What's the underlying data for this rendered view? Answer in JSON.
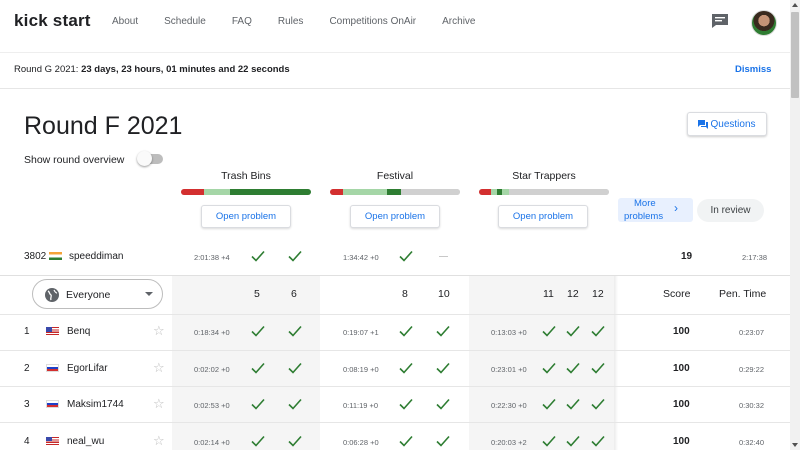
{
  "nav": {
    "logo": "kick start",
    "links": [
      "About",
      "Schedule",
      "FAQ",
      "Rules",
      "Competitions OnAir",
      "Archive"
    ]
  },
  "banner": {
    "label": "Round G 2021:",
    "countdown": "23 days, 23 hours, 01 minutes and 22 seconds",
    "dismiss": "Dismiss"
  },
  "round": {
    "title": "Round F 2021",
    "questions_label": "Questions",
    "overview_label": "Show round overview"
  },
  "problems": [
    {
      "name": "Trash Bins",
      "open_label": "Open problem",
      "bar": [
        [
          "#d32f2f",
          0.18
        ],
        [
          "#a5d6a7",
          0.2
        ],
        [
          "#2e7d32",
          0.62
        ]
      ]
    },
    {
      "name": "Festival",
      "open_label": "Open problem",
      "bar": [
        [
          "#d32f2f",
          0.1
        ],
        [
          "#a5d6a7",
          0.34
        ],
        [
          "#2e7d32",
          0.11
        ],
        [
          "#d0d0d0",
          0.45
        ]
      ]
    },
    {
      "name": "Star Trappers",
      "open_label": "Open problem",
      "bar": [
        [
          "#d32f2f",
          0.09
        ],
        [
          "#a5d6a7",
          0.05
        ],
        [
          "#2e7d32",
          0.04
        ],
        [
          "#a5d6a7",
          0.05
        ],
        [
          "#d0d0d0",
          0.77
        ]
      ]
    }
  ],
  "more_problems": {
    "line1": "More",
    "line2": "problems"
  },
  "in_review": "In review",
  "me": {
    "rank": "3802",
    "name": "speeddiman",
    "p1_time": "2:01:38 +4",
    "p2_time": "1:34:42 +0",
    "score": "19",
    "penalty": "2:17:38"
  },
  "filter": {
    "label": "Everyone"
  },
  "headers": {
    "p1": [
      "5",
      "6"
    ],
    "p2": [
      "8",
      "10"
    ],
    "p3": [
      "11",
      "12",
      "12"
    ],
    "score": "Score",
    "penalty": "Pen. Time"
  },
  "rows": [
    {
      "rank": "1",
      "name": "Benq",
      "flag": "us",
      "t1": "0:18:34 +0",
      "t2": "0:19:07 +1",
      "t3": "0:13:03 +0",
      "score": "100",
      "penalty": "0:23:07"
    },
    {
      "rank": "2",
      "name": "EgorLifar",
      "flag": "ru",
      "t1": "0:02:02 +0",
      "t2": "0:08:19 +0",
      "t3": "0:23:01 +0",
      "score": "100",
      "penalty": "0:29:22"
    },
    {
      "rank": "3",
      "name": "Maksim1744",
      "flag": "ru",
      "t1": "0:02:53 +0",
      "t2": "0:11:19 +0",
      "t3": "0:22:30 +0",
      "score": "100",
      "penalty": "0:30:32"
    },
    {
      "rank": "4",
      "name": "neal_wu",
      "flag": "us",
      "t1": "0:02:14 +0",
      "t2": "0:06:28 +0",
      "t3": "0:20:03 +2",
      "score": "100",
      "penalty": "0:32:40"
    }
  ],
  "colors": {
    "accent": "#1a73e8",
    "check": "#2e7d32",
    "shade": "#f5f5f5"
  }
}
